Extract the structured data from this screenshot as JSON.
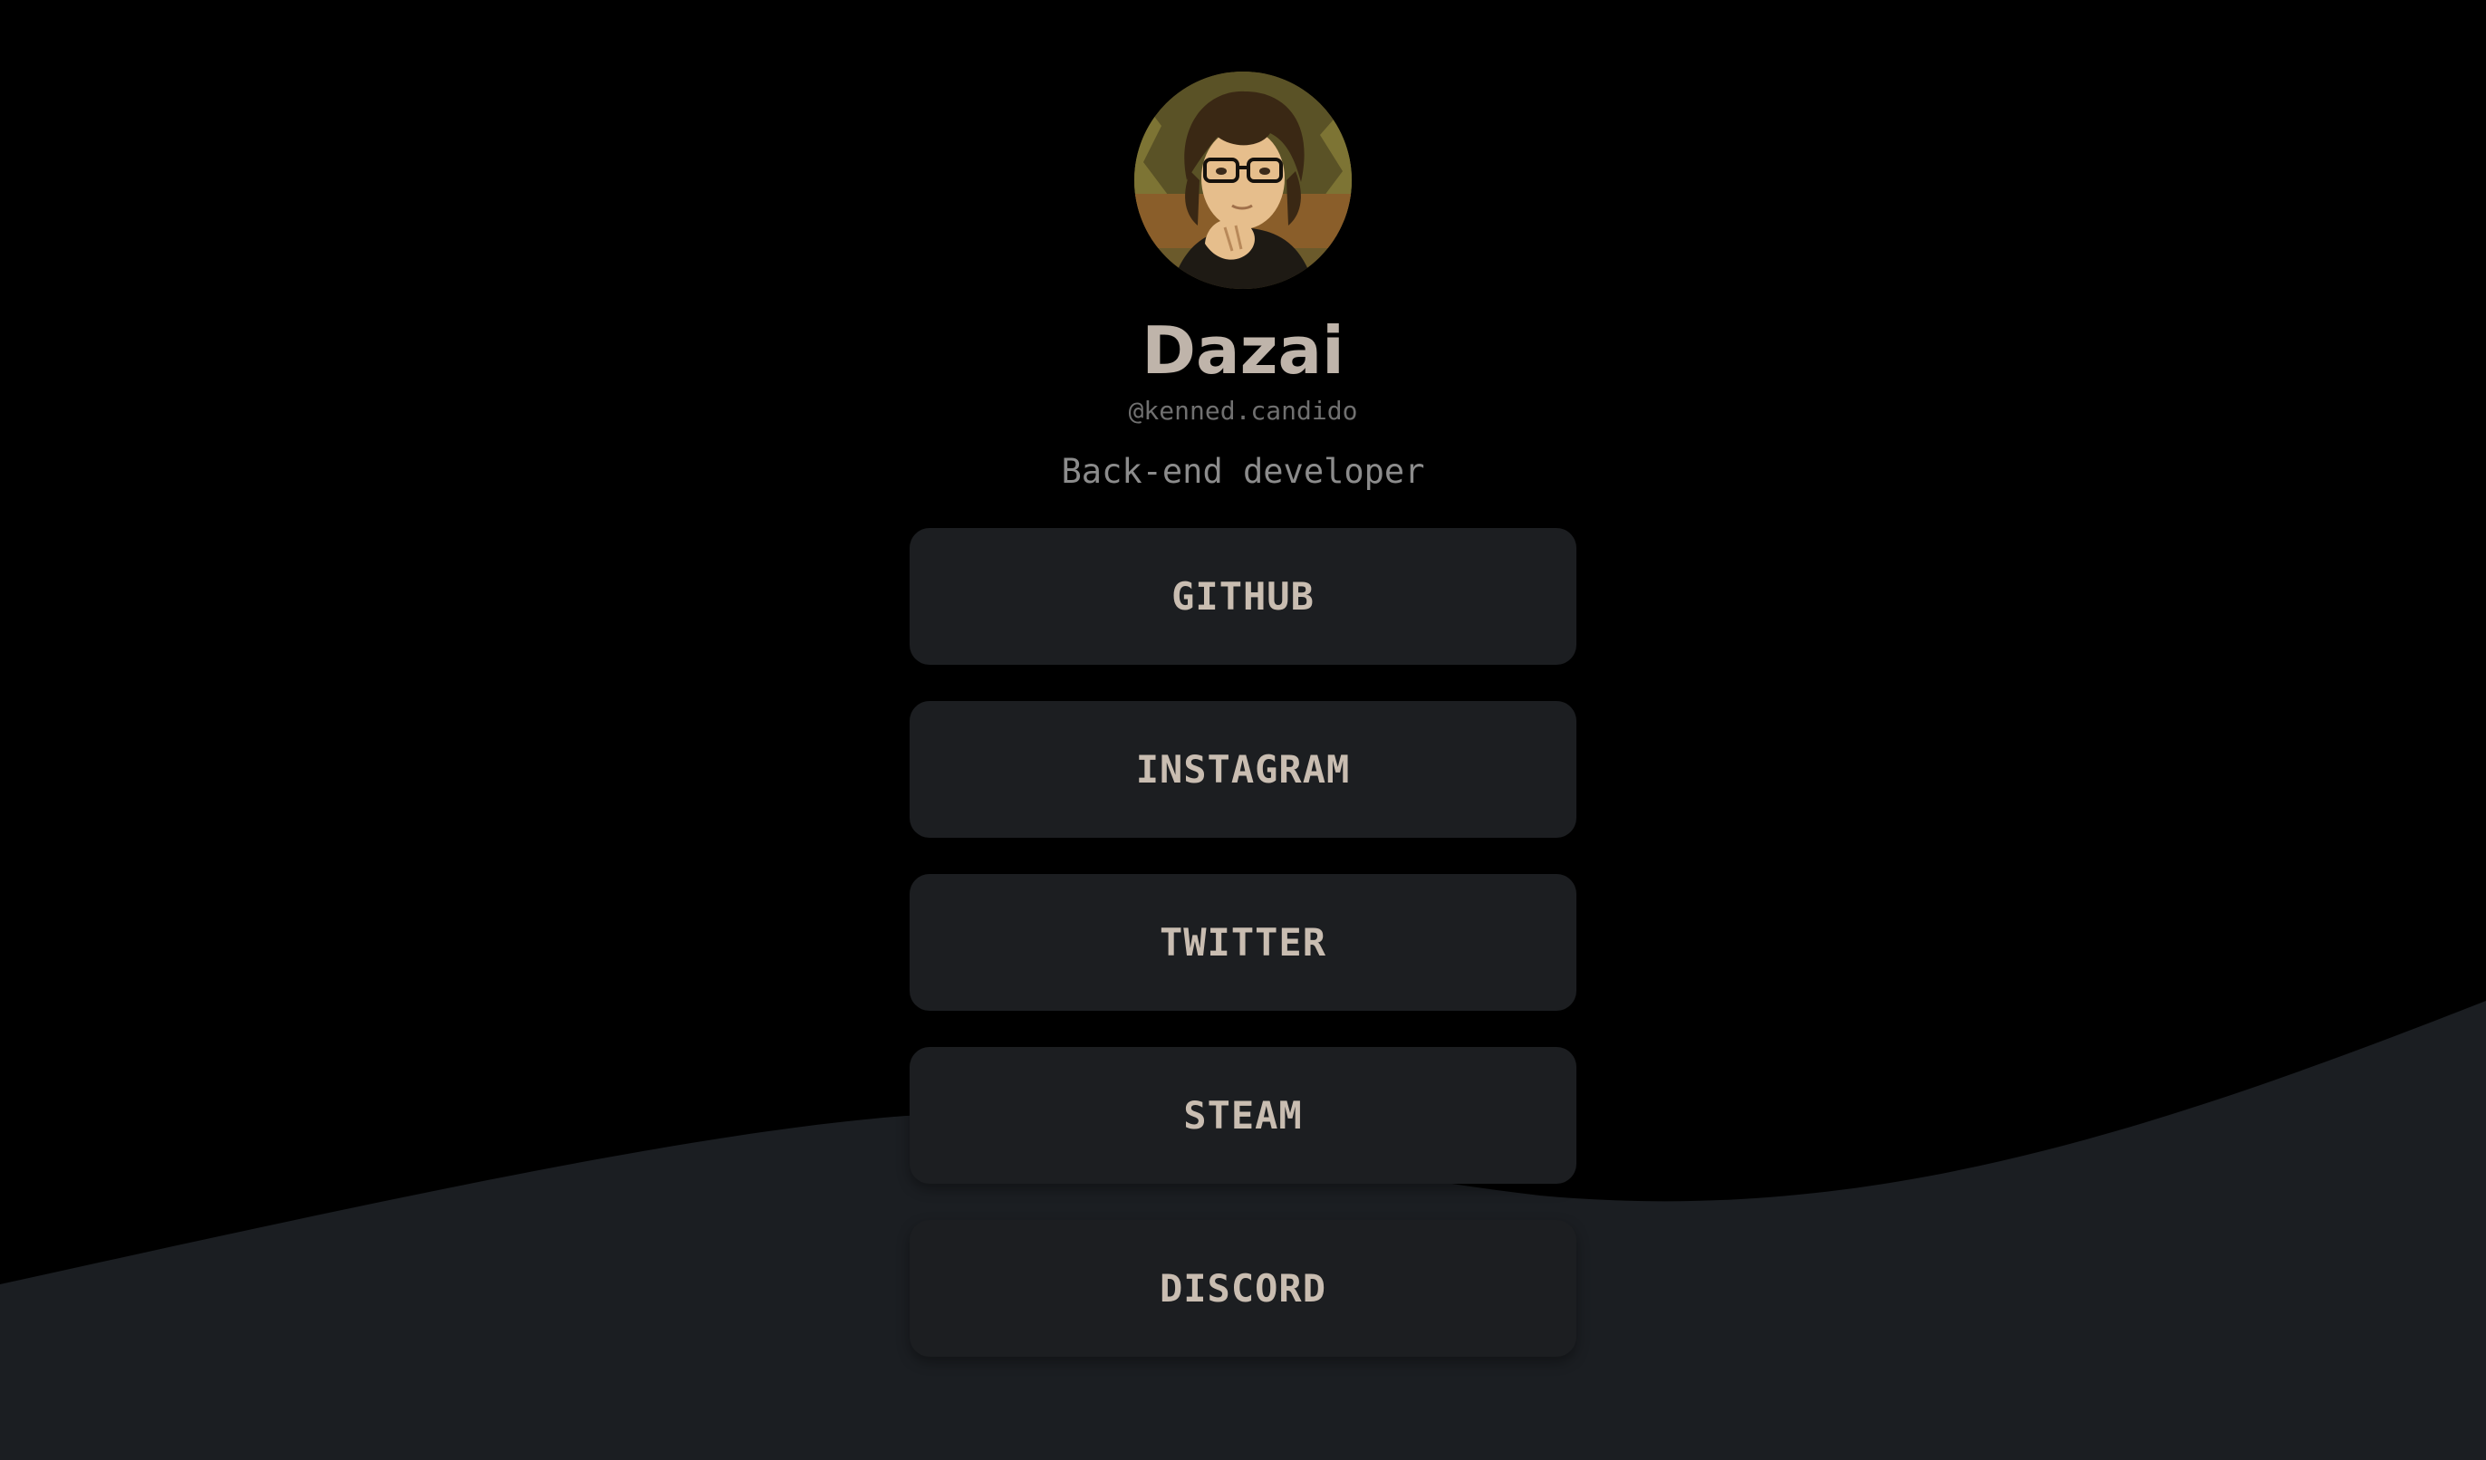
{
  "profile": {
    "name": "Dazai",
    "handle": "@kenned.candido",
    "bio": "Back-end developer",
    "avatar_icon": "anime-character-with-glasses"
  },
  "links": [
    {
      "label": "GITHUB"
    },
    {
      "label": "INSTAGRAM"
    },
    {
      "label": "TWITTER"
    },
    {
      "label": "STEAM"
    },
    {
      "label": "DISCORD"
    }
  ],
  "colors": {
    "background": "#000000",
    "wave": "#1b1e22",
    "button": "#1c1e21",
    "name_text": "#bfb4aa",
    "button_text": "#c9bdb1",
    "muted_text": "#8c8c8c"
  }
}
